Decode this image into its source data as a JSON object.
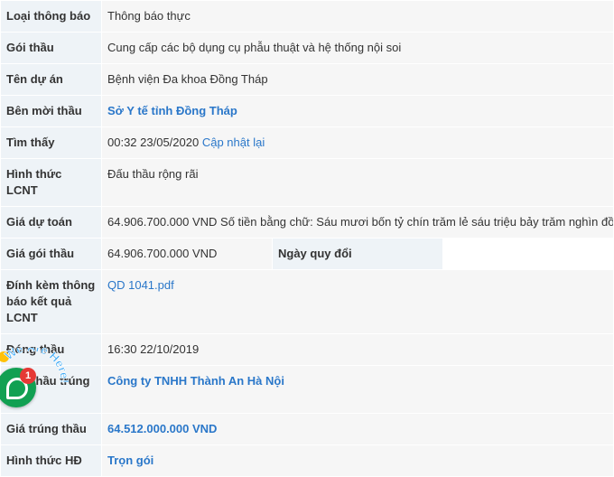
{
  "rows": {
    "loai_thong_bao": {
      "label": "Loại thông báo",
      "value": "Thông báo thực"
    },
    "goi_thau": {
      "label": "Gói thầu",
      "value": "Cung cấp các bộ dụng cụ phẫu thuật và hệ thống nội soi"
    },
    "ten_du_an": {
      "label": "Tên dự án",
      "value": "Bệnh viện Đa khoa Đồng Tháp"
    },
    "ben_moi_thau": {
      "label": "Bên mời thầu",
      "value": "Sở Y tế tỉnh Đồng Tháp"
    },
    "tim_thay": {
      "label": "Tìm thấy",
      "value": "00:32 23/05/2020",
      "link": "Cập nhật lại"
    },
    "hinh_thuc_lcnt": {
      "label": "Hình thức LCNT",
      "value": "Đấu thầu rộng rãi"
    },
    "gia_du_toan": {
      "label": "Giá dự toán",
      "value": "64.906.700.000 VND Số tiền bằng chữ: Sáu mươi bốn tỷ chín trăm lẻ sáu triệu bảy trăm nghìn đồng chẵn"
    },
    "gia_goi_thau": {
      "label": "Giá gói thầu",
      "value": "64.906.700.000 VND",
      "label2": "Ngày quy đổi",
      "value2": ""
    },
    "dinh_kem": {
      "label": "Đính kèm thông báo kết quả LCNT",
      "value": "QD 1041.pdf"
    },
    "dong_thau": {
      "label": "Đóng thầu",
      "value": "16:30 22/10/2019"
    },
    "nha_thau": {
      "label": "Nhà thầu trúng thầu",
      "value": "Công ty TNHH Thành An Hà Nội"
    },
    "gia_trung_thau": {
      "label": "Giá trúng thầu",
      "value": "64.512.000.000 VND"
    },
    "hinh_thuc_hd": {
      "label": "Hình thức HĐ",
      "value": "Trọn gói"
    }
  },
  "chat": {
    "badge": "1",
    "arc_text": "We Are Here!"
  },
  "colors": {
    "label_bg": "#eef3f7",
    "value_bg": "#f6f6f6",
    "link": "#2a77c9",
    "chat": "#11a052"
  }
}
